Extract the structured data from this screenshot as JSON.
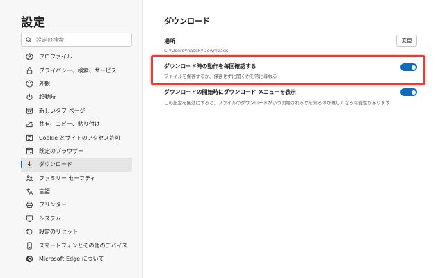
{
  "sidebar": {
    "title": "設定",
    "search_placeholder": "設定の検索",
    "items": [
      {
        "label": "プロファイル",
        "icon": "profile-icon"
      },
      {
        "label": "プライバシー、検索、サービス",
        "icon": "lock-icon"
      },
      {
        "label": "外観",
        "icon": "appearance-icon"
      },
      {
        "label": "起動時",
        "icon": "power-icon"
      },
      {
        "label": "新しいタブ ページ",
        "icon": "new-tab-icon"
      },
      {
        "label": "共有、コピー、貼り付け",
        "icon": "share-icon"
      },
      {
        "label": "Cookie とサイトのアクセス許可",
        "icon": "cookie-icon"
      },
      {
        "label": "既定のブラウザー",
        "icon": "browser-icon"
      },
      {
        "label": "ダウンロード",
        "icon": "download-icon",
        "active": true
      },
      {
        "label": "ファミリー セーフティ",
        "icon": "family-icon"
      },
      {
        "label": "言語",
        "icon": "language-icon"
      },
      {
        "label": "プリンター",
        "icon": "printer-icon"
      },
      {
        "label": "システム",
        "icon": "system-icon"
      },
      {
        "label": "設定のリセット",
        "icon": "reset-icon"
      },
      {
        "label": "スマートフォンとその他のデバイス",
        "icon": "phone-icon"
      },
      {
        "label": "Microsoft Edge について",
        "icon": "edge-icon"
      }
    ]
  },
  "main": {
    "title": "ダウンロード",
    "location": {
      "label": "場所",
      "path": "C:¥Users¥hasek¥Downloads",
      "change_button": "変更"
    },
    "settings": [
      {
        "title": "ダウンロード時の動作を毎回確認する",
        "description": "ファイルを保存するか、保存せずに開くかを常に尋ねる",
        "enabled": true
      },
      {
        "title": "ダウンロードの開始時にダウンロード メニューを表示",
        "description": "この設定を無効にすると、ファイルのダウンロードがいつ開始されるかを知るのが難しくなる可能性があります",
        "enabled": true
      }
    ]
  },
  "colors": {
    "accent": "#0f6cbd",
    "highlight": "#e0403a",
    "sidebar_bg": "#f7f7f7"
  }
}
